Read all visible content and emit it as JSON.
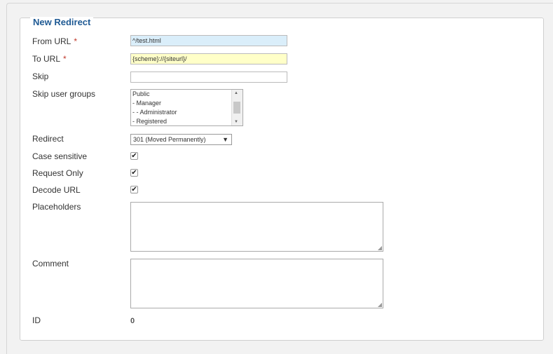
{
  "legend": "New Redirect",
  "fields": {
    "from_url": {
      "label": "From URL",
      "required": "*",
      "value": "^/test.html"
    },
    "to_url": {
      "label": "To URL",
      "required": "*",
      "value": "{scheme}://{siteurl}/"
    },
    "skip": {
      "label": "Skip",
      "value": ""
    },
    "skip_user_groups": {
      "label": "Skip user groups",
      "options": [
        "Public",
        "- Manager",
        "- - Administrator",
        "- Registered"
      ]
    },
    "redirect": {
      "label": "Redirect",
      "selected": "301 (Moved Permanently)"
    },
    "case_sensitive": {
      "label": "Case sensitive",
      "checked": true,
      "mark": "✔"
    },
    "request_only": {
      "label": "Request Only",
      "checked": true,
      "mark": "✔"
    },
    "decode_url": {
      "label": "Decode URL",
      "checked": true,
      "mark": "✔"
    },
    "placeholders": {
      "label": "Placeholders",
      "value": ""
    },
    "comment": {
      "label": "Comment",
      "value": ""
    },
    "id": {
      "label": "ID",
      "value": "0"
    }
  },
  "icons": {
    "scroll_up": "▲",
    "scroll_down": "▼",
    "select_arrow": "▼",
    "resize_grip": "◢"
  },
  "colors": {
    "legend": "#1f5a94",
    "required": "#c0392b",
    "from_url_bg": "#daeefa",
    "to_url_bg": "#ffffc8"
  }
}
